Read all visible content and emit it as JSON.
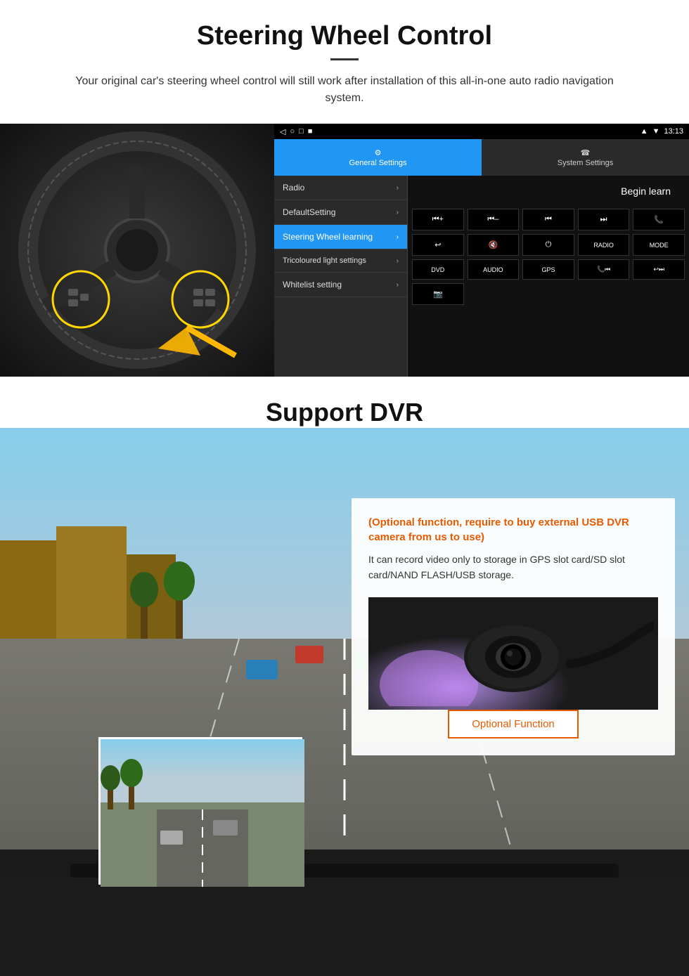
{
  "steering": {
    "title": "Steering Wheel Control",
    "subtitle": "Your original car's steering wheel control will still work after installation of this all-in-one auto radio navigation system.",
    "statusbar": {
      "time": "13:13",
      "signal": "▼",
      "wifi": "▾"
    },
    "nav_icons": [
      "◁",
      "○",
      "□",
      "■"
    ],
    "tabs": {
      "general": {
        "label": "General Settings",
        "icon": "⚙"
      },
      "system": {
        "label": "System Settings",
        "icon": "🔧"
      }
    },
    "menu_items": [
      {
        "label": "Radio",
        "active": false
      },
      {
        "label": "DefaultSetting",
        "active": false
      },
      {
        "label": "Steering Wheel learning",
        "active": true
      },
      {
        "label": "Tricoloured light settings",
        "active": false
      },
      {
        "label": "Whitelist setting",
        "active": false
      }
    ],
    "begin_learn": "Begin learn",
    "control_buttons": [
      "⏮+",
      "⏮–",
      "⏮|",
      "⏭|",
      "📞",
      "↩",
      "🔇",
      "⏻",
      "RADIO",
      "MODE",
      "DVD",
      "AUDIO",
      "GPS",
      "📞⏮|",
      "↩⏭|",
      "🎥"
    ]
  },
  "dvr": {
    "title": "Support DVR",
    "optional_text": "(Optional function, require to buy external USB DVR camera from us to use)",
    "desc_text": "It can record video only to storage in GPS slot card/SD slot card/NAND FLASH/USB storage.",
    "optional_function_label": "Optional Function"
  }
}
